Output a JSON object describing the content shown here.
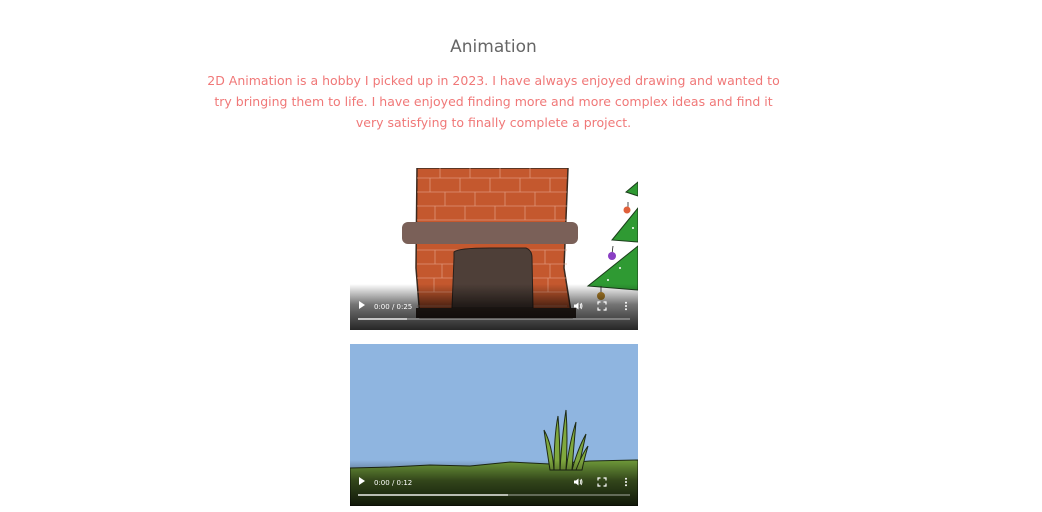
{
  "section": {
    "title": "Animation",
    "description": "2D Animation is a hobby I picked up in 2023. I have always enjoyed drawing and wanted to try bringing them to life. I have enjoyed finding more and more complex ideas and find it very satisfying to finally complete a project."
  },
  "videos": [
    {
      "time": "0:00 / 0:25",
      "buffered": 0.18,
      "scene": "fireplace-christmas-tree"
    },
    {
      "time": "0:00 / 0:12",
      "buffered": 0.55,
      "scene": "grass-field-sky"
    }
  ],
  "colors": {
    "title": "#666666",
    "description": "#f07878",
    "brick": "#c4582e",
    "mantel": "#7a6058",
    "sky": "#8fb5e0",
    "grass": "#6f9a3a",
    "tree": "#2f9a33"
  }
}
